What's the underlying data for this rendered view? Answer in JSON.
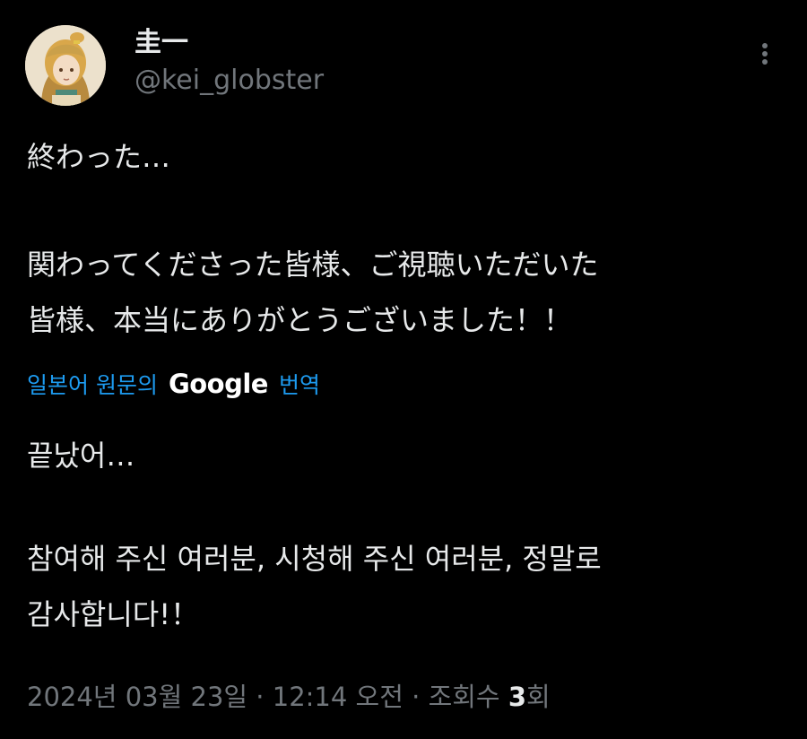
{
  "author": {
    "display_name": "圭一",
    "handle": "@kei_globster",
    "avatar_icon": "avatar-illustration"
  },
  "menu": {
    "more_icon": "more-vertical-icon"
  },
  "tweet": {
    "original_lines": [
      "終わった…",
      "関わってくださった皆様、ご視聴いただいた",
      "皆様、本当にありがとうございました！！"
    ],
    "translation_label": {
      "prefix": "일본어 원문의",
      "brand": "Google",
      "suffix": "번역"
    },
    "translated_lines": [
      "끝났어…",
      "참여해 주신 여러분, 시청해 주신 여러분, 정말로",
      "감사합니다!！"
    ]
  },
  "meta": {
    "date": "2024년 03월 23일",
    "sep1": " · ",
    "time": "12:14 오전",
    "sep2": " · ",
    "views_label": "조회수 ",
    "views_count": "3",
    "views_suffix": "회"
  },
  "colors": {
    "background": "#000000",
    "text": "#e7e9ea",
    "secondary": "#71767b",
    "link": "#1d9bf0"
  }
}
